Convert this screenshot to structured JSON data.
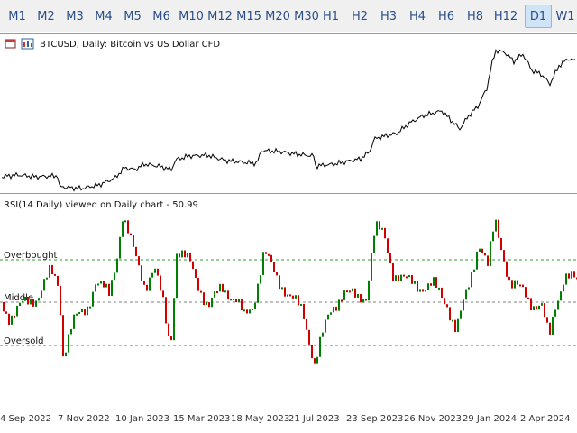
{
  "timeframes": {
    "items": [
      {
        "label": "M1",
        "active": false
      },
      {
        "label": "M2",
        "active": false
      },
      {
        "label": "M3",
        "active": false
      },
      {
        "label": "M4",
        "active": false
      },
      {
        "label": "M5",
        "active": false
      },
      {
        "label": "M6",
        "active": false
      },
      {
        "label": "M10",
        "active": false
      },
      {
        "label": "M12",
        "active": false
      },
      {
        "label": "M15",
        "active": false
      },
      {
        "label": "M20",
        "active": false
      },
      {
        "label": "M30",
        "active": false
      },
      {
        "label": "H1",
        "active": false
      },
      {
        "label": "H2",
        "active": false
      },
      {
        "label": "H3",
        "active": false
      },
      {
        "label": "H4",
        "active": false
      },
      {
        "label": "H6",
        "active": false
      },
      {
        "label": "H8",
        "active": false
      },
      {
        "label": "H12",
        "active": false
      },
      {
        "label": "D1",
        "active": true
      },
      {
        "label": "W1",
        "active": false
      }
    ]
  },
  "main_chart": {
    "title": "BTCUSD, Daily:  Bitcoin vs US Dollar CFD",
    "icons": [
      "chart-window-icon",
      "symbol-properties-icon"
    ]
  },
  "rsi_chart": {
    "title": "RSI(14 Daily) viewed on Daily chart -  50.99",
    "levels": {
      "overbought": "Overbought",
      "middle": "Middle",
      "oversold": "Oversold"
    }
  },
  "time_axis": {
    "labels": [
      "4 Sep 2022",
      "7 Nov 2022",
      "10 Jan 2023",
      "15 Mar 2023",
      "18 May 2023",
      "21 Jul 2023",
      "23 Sep 2023",
      "26 Nov 2023",
      "29 Jan 2024",
      "2 Apr 2024"
    ]
  },
  "colors": {
    "up_bar": "#008000",
    "down_bar": "#d00000",
    "price_line": "#000000",
    "overbought_line": "#2e9e2e",
    "middle_line": "#808080",
    "oversold_line": "#d04040"
  }
}
